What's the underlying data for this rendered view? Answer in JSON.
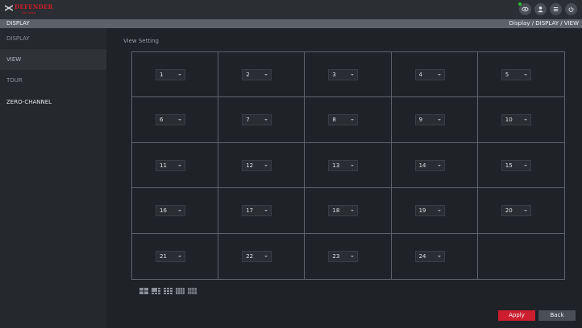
{
  "brand": {
    "logo_text": "DEFENDER",
    "logo_sub": "Security"
  },
  "header": {
    "icons": [
      "eye-icon",
      "user-icon",
      "menu-icon",
      "power-icon"
    ],
    "status_dot_color": "#22c433"
  },
  "titlebar": {
    "title": "DISPLAY",
    "breadcrumb": "Display  /  DISPLAY  /  VIEW"
  },
  "sidebar": {
    "items": [
      {
        "label": "DISPLAY"
      },
      {
        "label": "VIEW"
      },
      {
        "label": "TOUR"
      },
      {
        "label": "ZERO-CHANNEL"
      }
    ]
  },
  "main": {
    "section_title": "View Setting",
    "cells": [
      "1",
      "2",
      "3",
      "4",
      "5",
      "6",
      "7",
      "8",
      "9",
      "10",
      "11",
      "12",
      "13",
      "14",
      "15",
      "16",
      "17",
      "18",
      "19",
      "20",
      "21",
      "22",
      "23",
      "24"
    ],
    "layout_icons": [
      "layout-4-icon",
      "layout-8-icon",
      "layout-9-icon",
      "layout-16-icon",
      "layout-25-icon"
    ]
  },
  "buttons": {
    "apply": "Apply",
    "back": "Back"
  },
  "colors": {
    "accent": "#cc1e2e"
  }
}
